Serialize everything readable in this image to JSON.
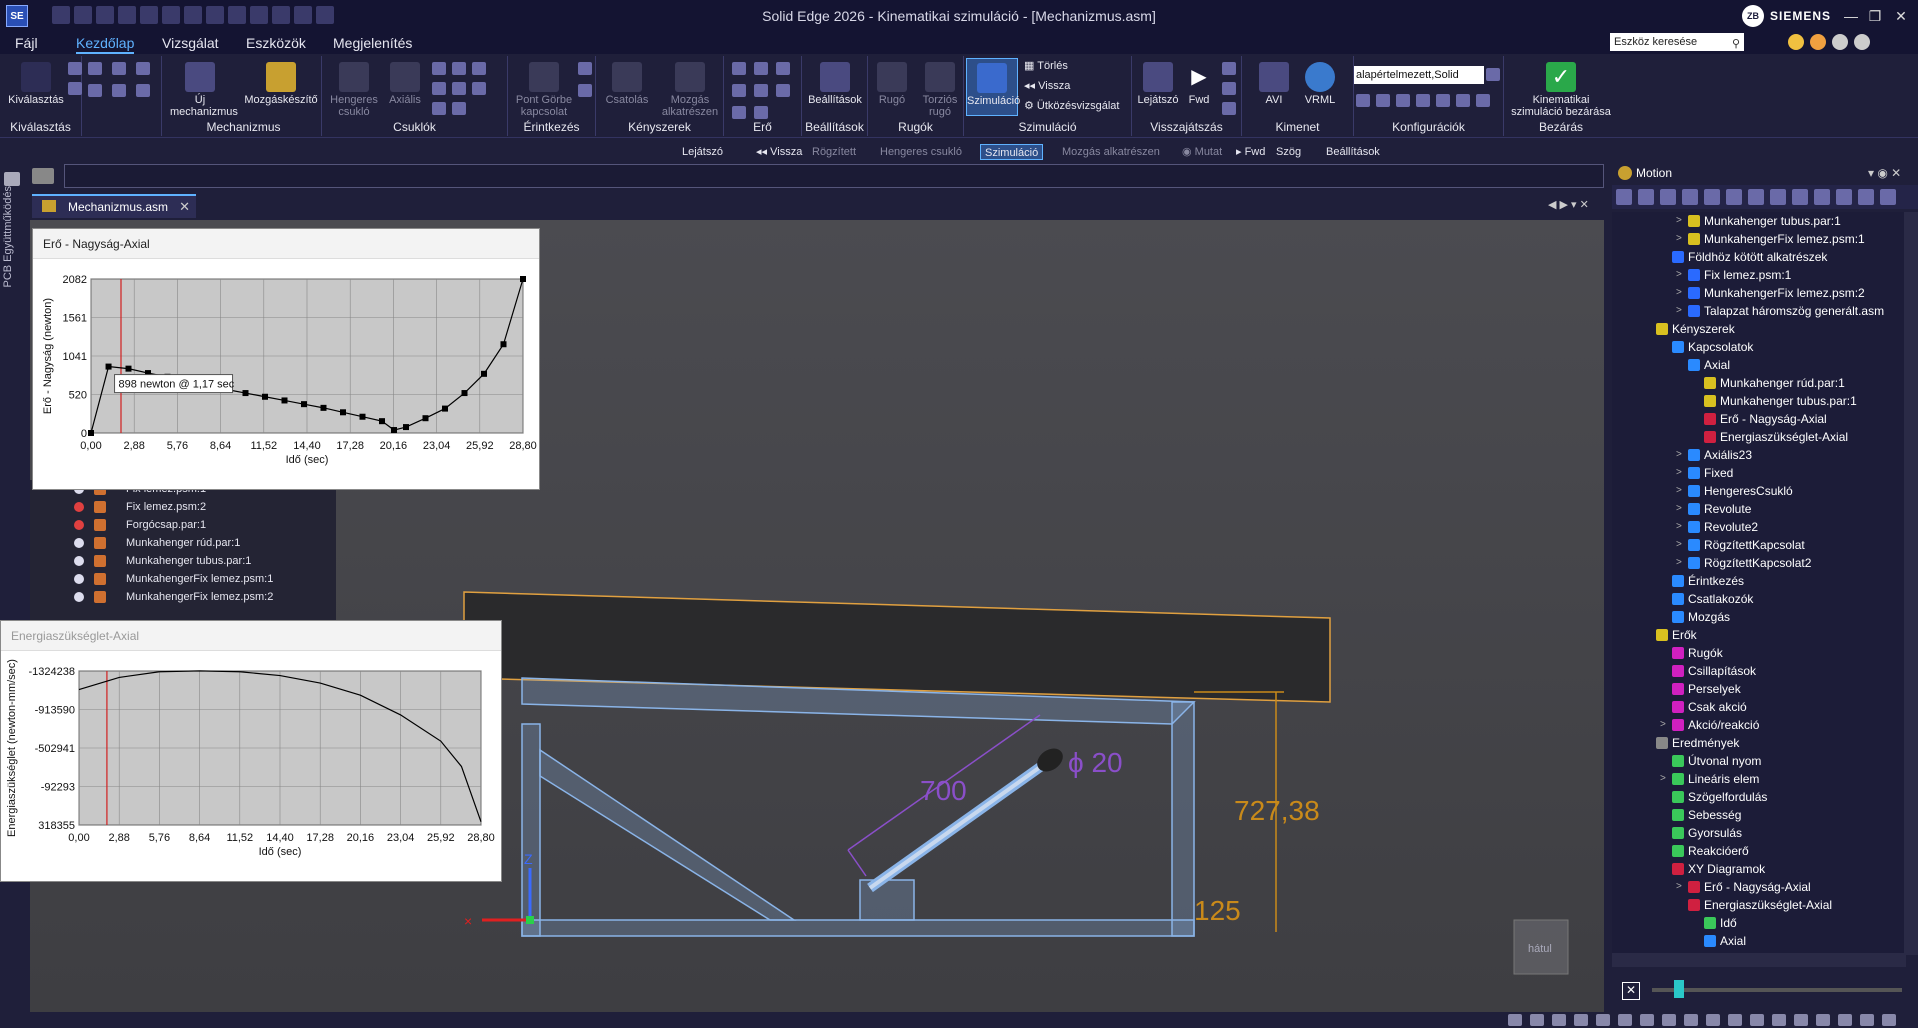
{
  "app": {
    "title": "Solid Edge 2026 - Kinematikai szimuláció - [Mechanizmus.asm]",
    "logo": "SE",
    "user_initials": "ZB",
    "brand": "SIEMENS"
  },
  "menu": {
    "items": [
      "Fájl",
      "Kezdőlap",
      "Vizsgálat",
      "Eszközök",
      "Megjelenítés"
    ],
    "active": "Kezdőlap",
    "search_placeholder": "Eszköz keresése"
  },
  "ribbon": {
    "groups": {
      "kivalasztas": {
        "label": "Kiválasztás",
        "button": "Kiválasztás"
      },
      "mechanizmus": {
        "label": "Mechanizmus",
        "new": "Új mechanizmus",
        "wizard": "Mozgáskészítő"
      },
      "csuklok": {
        "label": "Csuklók",
        "cyl": "Hengeres csukló",
        "axial": "Axiális"
      },
      "erintkezes": {
        "label": "Érintkezés",
        "curve": "Pont Görbe kapcsolat"
      },
      "kenyszerek": {
        "label": "Kényszerek",
        "coupling": "Csatolás",
        "motion": "Mozgás alkatrészen"
      },
      "ero": {
        "label": "Erő"
      },
      "beallitasok": {
        "label": "Beállítások",
        "button": "Beállítások"
      },
      "rugok": {
        "label": "Rugók",
        "spring": "Rugó",
        "torsion": "Torziós rugó"
      },
      "szimulacio": {
        "label": "Szimuláció",
        "sim": "Szimuláció",
        "delete": "Törlés",
        "back": "Vissza",
        "collision": "Ütközésvizsgálat"
      },
      "visszajatszas": {
        "label": "Visszajátszás",
        "player": "Lejátszó",
        "fwd": "Fwd"
      },
      "kimenet": {
        "label": "Kimenet",
        "avi": "AVI",
        "vrml": "VRML"
      },
      "konfiguraciok": {
        "label": "Konfigurációk",
        "value": "alapértelmezett,Solid"
      },
      "bezaras": {
        "label": "Bezárás",
        "close": "Kinematikai szimuláció bezárása"
      }
    }
  },
  "command_bar": [
    {
      "label": "Lejátszó",
      "state": "normal"
    },
    {
      "label": "Vissza",
      "state": "normal"
    },
    {
      "label": "Rögzített",
      "state": "dim"
    },
    {
      "label": "Hengeres csukló",
      "state": "dim"
    },
    {
      "label": "Szimuláció",
      "state": "selected"
    },
    {
      "label": "Mozgás alkatrészen",
      "state": "dim"
    },
    {
      "label": "Mutat",
      "state": "dim"
    },
    {
      "label": "Fwd",
      "state": "normal"
    },
    {
      "label": "Szög",
      "state": "normal"
    },
    {
      "label": "Beállítások",
      "state": "normal"
    }
  ],
  "side_strip": {
    "label": "PCB Együttműködés"
  },
  "doc_tab": {
    "label": "Mechanizmus.asm"
  },
  "left_tree": [
    {
      "label": "Fix lemez.psm:1",
      "visible": true
    },
    {
      "label": "Fix lemez.psm:2",
      "visible": false
    },
    {
      "label": "Forgócsap.par:1",
      "visible": false
    },
    {
      "label": "Munkahenger rúd.par:1",
      "visible": true
    },
    {
      "label": "Munkahenger tubus.par:1",
      "visible": true
    },
    {
      "label": "MunkahengerFix lemez.psm:1",
      "visible": true
    },
    {
      "label": "MunkahengerFix lemez.psm:2",
      "visible": true
    }
  ],
  "chart1": {
    "window_title": "Erő - Nagyság-Axial",
    "tooltip": "898 newton @ 1,17 sec",
    "chart_data": {
      "type": "line",
      "title": "Erő - Nagyság-Axial",
      "xlabel": "Idő (sec)",
      "ylabel": "Erő - Nagyság (newton)",
      "xlim": [
        0,
        28.8
      ],
      "ylim": [
        0,
        2082
      ],
      "x_ticks": [
        "0,00",
        "2,88",
        "5,76",
        "8,64",
        "11,52",
        "14,40",
        "17,28",
        "20,16",
        "23,04",
        "25,92",
        "28,80"
      ],
      "y_ticks": [
        "0",
        "520",
        "1041",
        "1561",
        "2082"
      ],
      "x": [
        0,
        1.17,
        2.5,
        3.8,
        5.1,
        6.4,
        7.7,
        9.0,
        10.3,
        11.6,
        12.9,
        14.2,
        15.5,
        16.8,
        18.1,
        19.4,
        20.2,
        21.0,
        22.3,
        23.6,
        24.9,
        26.2,
        27.5,
        28.8
      ],
      "y": [
        0,
        898,
        870,
        810,
        760,
        700,
        640,
        590,
        540,
        490,
        440,
        390,
        340,
        280,
        220,
        160,
        40,
        80,
        200,
        330,
        540,
        800,
        1200,
        2082
      ],
      "marker_x": 2.0,
      "grid": true
    }
  },
  "chart2": {
    "window_title": "Energiaszükséglet-Axial",
    "chart_data": {
      "type": "line",
      "title": "Energiaszükséglet-Axial",
      "xlabel": "Idő (sec)",
      "ylabel": "Energiaszükséglet (newton-mm/sec)",
      "xlim": [
        0,
        28.8
      ],
      "ylim": [
        -1324238,
        318355
      ],
      "x_ticks": [
        "0,00",
        "2,88",
        "5,76",
        "8,64",
        "11,52",
        "14,40",
        "17,28",
        "20,16",
        "23,04",
        "25,92",
        "28,80"
      ],
      "y_ticks": [
        "318355",
        "-92293",
        "-502941",
        "-913590",
        "-1324238"
      ],
      "x": [
        0,
        2.88,
        5.76,
        8.64,
        11.52,
        14.4,
        17.28,
        20.16,
        23.04,
        25.92,
        27.4,
        28.8
      ],
      "y": [
        120000,
        250000,
        310000,
        320000,
        310000,
        270000,
        190000,
        60000,
        -150000,
        -430000,
        -700000,
        -1290000
      ],
      "marker_x": 2.0,
      "grid": true
    }
  },
  "viewport": {
    "dims": {
      "stroke": "700",
      "diameter": "20",
      "height": "727,38",
      "small": "125"
    },
    "view_cube_label": "hátul",
    "triad_z": "Z"
  },
  "motion": {
    "title": "Motion",
    "tree": [
      {
        "label": "Munkahenger tubus.par:1",
        "level": 3,
        "icon": "part",
        "exp": true
      },
      {
        "label": "MunkahengerFix lemez.psm:1",
        "level": 3,
        "icon": "part",
        "exp": true
      },
      {
        "label": "Földhöz kötött alkatrészek",
        "level": 2,
        "icon": "ground",
        "exp": false
      },
      {
        "label": "Fix lemez.psm:1",
        "level": 3,
        "icon": "ground",
        "exp": true
      },
      {
        "label": "MunkahengerFix lemez.psm:2",
        "level": 3,
        "icon": "ground",
        "exp": true
      },
      {
        "label": "Talapzat háromszög generált.asm",
        "level": 3,
        "icon": "ground",
        "exp": true
      },
      {
        "label": "Kényszerek",
        "level": 1,
        "icon": "constraint",
        "exp": false
      },
      {
        "label": "Kapcsolatok",
        "level": 2,
        "icon": "joint",
        "exp": false
      },
      {
        "label": "Axial",
        "level": 3,
        "icon": "joint",
        "exp": false
      },
      {
        "label": "Munkahenger rúd.par:1",
        "level": 4,
        "icon": "part",
        "exp": false
      },
      {
        "label": "Munkahenger tubus.par:1",
        "level": 4,
        "icon": "part",
        "exp": false
      },
      {
        "label": "Erő - Nagyság-Axial",
        "level": 4,
        "icon": "graph",
        "exp": false
      },
      {
        "label": "Energiaszükséglet-Axial",
        "level": 4,
        "icon": "graph",
        "exp": false
      },
      {
        "label": "Axiális23",
        "level": 3,
        "icon": "joint",
        "exp": true
      },
      {
        "label": "Fixed",
        "level": 3,
        "icon": "lock",
        "exp": true
      },
      {
        "label": "HengeresCsukló",
        "level": 3,
        "icon": "joint",
        "exp": true
      },
      {
        "label": "Revolute",
        "level": 3,
        "icon": "joint",
        "exp": true
      },
      {
        "label": "Revolute2",
        "level": 3,
        "icon": "joint",
        "exp": true
      },
      {
        "label": "RögzítettKapcsolat",
        "level": 3,
        "icon": "lock",
        "exp": true
      },
      {
        "label": "RögzítettKapcsolat2",
        "level": 3,
        "icon": "lock",
        "exp": true
      },
      {
        "label": "Érintkezés",
        "level": 2,
        "icon": "joint",
        "exp": false
      },
      {
        "label": "Csatlakozók",
        "level": 2,
        "icon": "joint",
        "exp": false
      },
      {
        "label": "Mozgás",
        "level": 2,
        "icon": "motion",
        "exp": false
      },
      {
        "label": "Erők",
        "level": 1,
        "icon": "force",
        "exp": false
      },
      {
        "label": "Rugók",
        "level": 2,
        "icon": "spring",
        "exp": false
      },
      {
        "label": "Csillapítások",
        "level": 2,
        "icon": "spring",
        "exp": false
      },
      {
        "label": "Perselyek",
        "level": 2,
        "icon": "spring",
        "exp": false
      },
      {
        "label": "Csak akció",
        "level": 2,
        "icon": "spring",
        "exp": false
      },
      {
        "label": "Akció/reakció",
        "level": 2,
        "icon": "spring",
        "exp": true
      },
      {
        "label": "Eredmények",
        "level": 1,
        "icon": "results",
        "exp": false
      },
      {
        "label": "Útvonal nyom",
        "level": 2,
        "icon": "trace",
        "exp": false
      },
      {
        "label": "Lineáris elem",
        "level": 2,
        "icon": "trace",
        "exp": true
      },
      {
        "label": "Szögelfordulás",
        "level": 2,
        "icon": "trace",
        "exp": false
      },
      {
        "label": "Sebesség",
        "level": 2,
        "icon": "trace",
        "exp": false
      },
      {
        "label": "Gyorsulás",
        "level": 2,
        "icon": "trace",
        "exp": false
      },
      {
        "label": "Reakcióerő",
        "level": 2,
        "icon": "trace",
        "exp": false
      },
      {
        "label": "XY Diagramok",
        "level": 2,
        "icon": "graph",
        "exp": false
      },
      {
        "label": "Erő - Nagyság-Axial",
        "level": 3,
        "icon": "graph",
        "exp": true
      },
      {
        "label": "Energiaszükséglet-Axial",
        "level": 3,
        "icon": "graph",
        "exp": false
      },
      {
        "label": "Idő",
        "level": 4,
        "icon": "trace",
        "exp": false
      },
      {
        "label": "Axial",
        "level": 4,
        "icon": "joint",
        "exp": false
      }
    ]
  },
  "colors": {
    "accent": "#5fb2ff",
    "dimension": "#8a4fc9",
    "dimension_orange": "#c98a1a",
    "frame": "#8ab4e8"
  }
}
